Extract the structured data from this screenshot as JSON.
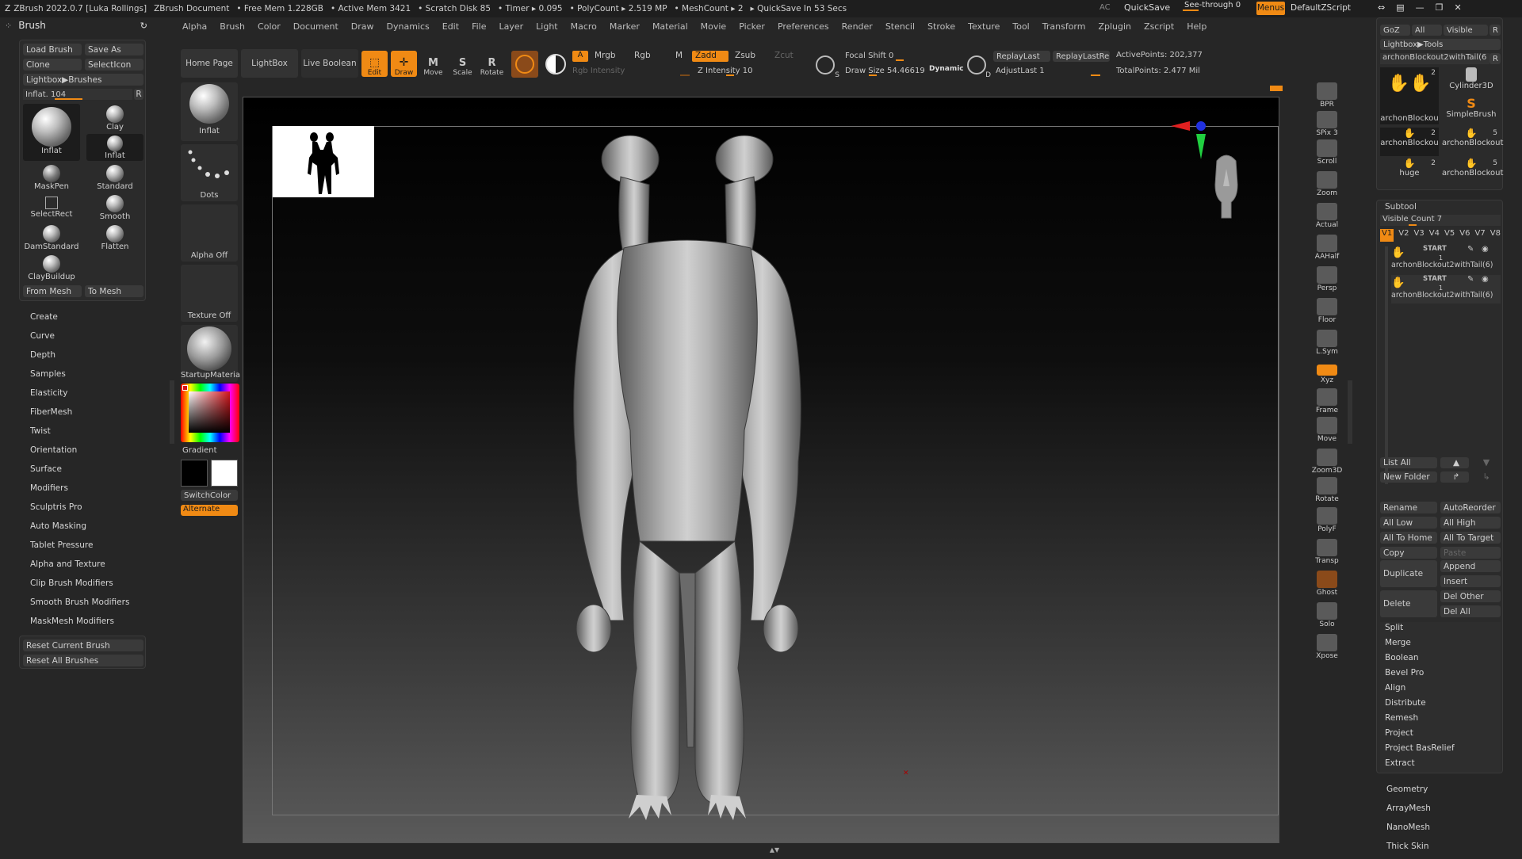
{
  "titlebar": {
    "app": "ZBrush 2022.0.7 [Luka Rollings]",
    "doc": "ZBrush Document",
    "free_mem": "• Free Mem 1.228GB",
    "active_mem": "• Active Mem 3421",
    "scratch": "• Scratch Disk 85",
    "timer": "• Timer ▸ 0.095",
    "polycount": "• PolyCount ▸ 2.519 MP",
    "meshcount": "• MeshCount ▸ 2",
    "quicksave_in": "▸ QuickSave In 53 Secs",
    "ac": "AC",
    "quicksave": "QuickSave",
    "see_through": "See-through  0",
    "menus": "Menus",
    "default_zscript": "DefaultZScript"
  },
  "menubar": [
    "Alpha",
    "Brush",
    "Color",
    "Document",
    "Draw",
    "Dynamics",
    "Edit",
    "File",
    "Layer",
    "Light",
    "Macro",
    "Marker",
    "Material",
    "Movie",
    "Picker",
    "Preferences",
    "Render",
    "Stencil",
    "Stroke",
    "Texture",
    "Tool",
    "Transform",
    "Zplugin",
    "Zscript",
    "Help"
  ],
  "brush_panel": {
    "title": "Brush",
    "load": "Load Brush",
    "save_as": "Save As",
    "clone": "Clone",
    "select_icon": "SelectIcon",
    "lightbox": "Lightbox▶Brushes",
    "inflat_slider": "Inflat. 104",
    "r": "R",
    "brushes": [
      {
        "name": "Inflat",
        "big": true
      },
      {
        "name": "Clay"
      },
      {
        "name": "Inflat"
      },
      {
        "name": "MaskPen"
      },
      {
        "name": "Standard"
      },
      {
        "name": "SelectRect"
      },
      {
        "name": "Smooth"
      },
      {
        "name": "DamStandard"
      },
      {
        "name": "Flatten"
      },
      {
        "name": "ClayBuildup"
      }
    ],
    "from_mesh": "From Mesh",
    "to_mesh": "To Mesh",
    "menu": [
      "Create",
      "Curve",
      "Depth",
      "Samples",
      "Elasticity",
      "FiberMesh",
      "Twist",
      "Orientation",
      "Surface",
      "Modifiers",
      "Sculptris Pro",
      "Auto Masking",
      "Tablet Pressure",
      "Alpha and Texture",
      "Clip Brush Modifiers",
      "Smooth Brush Modifiers",
      "MaskMesh Modifiers"
    ],
    "reset_current": "Reset Current Brush",
    "reset_all": "Reset All Brushes"
  },
  "toolbar": {
    "home": "Home Page",
    "lightbox": "LightBox",
    "live_boolean": "Live Boolean",
    "edit": "Edit",
    "draw": "Draw",
    "move": "Move",
    "scale": "Scale",
    "rotate": "Rotate",
    "a": "A",
    "mrgb": "Mrgb",
    "rgb": "Rgb",
    "m": "M",
    "rgb_intensity": "Rgb Intensity",
    "zadd": "Zadd",
    "zsub": "Zsub",
    "zcut": "Zcut",
    "z_intensity": "Z Intensity 10",
    "focal_shift": "Focal Shift 0",
    "draw_size": "Draw Size 54.46619",
    "dynamic": "Dynamic",
    "replay_last": "ReplayLast",
    "replay_last_rel": "ReplayLastRel",
    "adjust_last": "AdjustLast 1",
    "active_points": "ActivePoints: 202,377",
    "total_points": "TotalPoints: 2.477 Mil",
    "s": "S",
    "d": "D"
  },
  "left_shelf": {
    "inflat": "Inflat",
    "dots": "Dots",
    "alpha_off": "Alpha Off",
    "texture_off": "Texture Off",
    "material": "StartupMateria",
    "gradient": "Gradient",
    "switch_color": "SwitchColor",
    "alternate": "Alternate"
  },
  "right_shelf": [
    "BPR",
    "SPix 3",
    "Scroll",
    "Zoom",
    "Actual",
    "AAHalf",
    "Persp",
    "Floor",
    "L.Sym",
    "Xyz",
    "Frame",
    "Move",
    "Zoom3D",
    "Rotate",
    "PolyF",
    "Transp",
    "Ghost",
    "Solo",
    "Xpose"
  ],
  "tool_panel": {
    "goz": "GoZ",
    "all": "All",
    "visible": "Visible",
    "r": "R",
    "lightbox_tools": "Lightbox▶Tools",
    "current_tool": "archonBlockout2withTail(6",
    "tools": [
      {
        "name": "archonBlockou",
        "count": "2"
      },
      {
        "name": "Cylinder3D",
        "count": ""
      },
      {
        "name": "SimpleBrush",
        "count": ""
      },
      {
        "name": "archonBlockou",
        "count": "2"
      },
      {
        "name": "archonBlockout",
        "count": "5"
      },
      {
        "name": "huge",
        "count": "2"
      },
      {
        "name": "archonBlockout",
        "count": "5"
      }
    ],
    "subtool_title": "Subtool",
    "visible_count": "Visible Count 7",
    "versions": [
      "V1",
      "V2",
      "V3",
      "V4",
      "V5",
      "V6",
      "V7",
      "V8"
    ],
    "subtools": [
      {
        "tag": "START",
        "count": "1",
        "name": "archonBlockout2withTail(6)"
      },
      {
        "tag": "START",
        "count": "1",
        "name": "archonBlockout2withTail(6)"
      }
    ],
    "list_all": "List All",
    "new_folder": "New Folder",
    "actions": [
      [
        "Rename",
        "AutoReorder"
      ],
      [
        "All Low",
        "All High"
      ],
      [
        "All To Home",
        "All To Target"
      ],
      [
        "Copy",
        "Paste"
      ]
    ],
    "duplicate": "Duplicate",
    "append": "Append",
    "insert": "Insert",
    "delete": "Delete",
    "del_other": "Del Other",
    "del_all": "Del All",
    "single": [
      "Split",
      "Merge",
      "Boolean",
      "Bevel Pro",
      "Align",
      "Distribute",
      "Remesh",
      "Project",
      "Project BasRelief",
      "Extract"
    ],
    "bottom": [
      "Geometry",
      "ArrayMesh",
      "NanoMesh",
      "Thick Skin"
    ]
  },
  "colors": {
    "accent": "#f08a14",
    "bg": "#262626",
    "canvas_top": "#000000",
    "canvas_bottom": "#5a5a5a"
  }
}
